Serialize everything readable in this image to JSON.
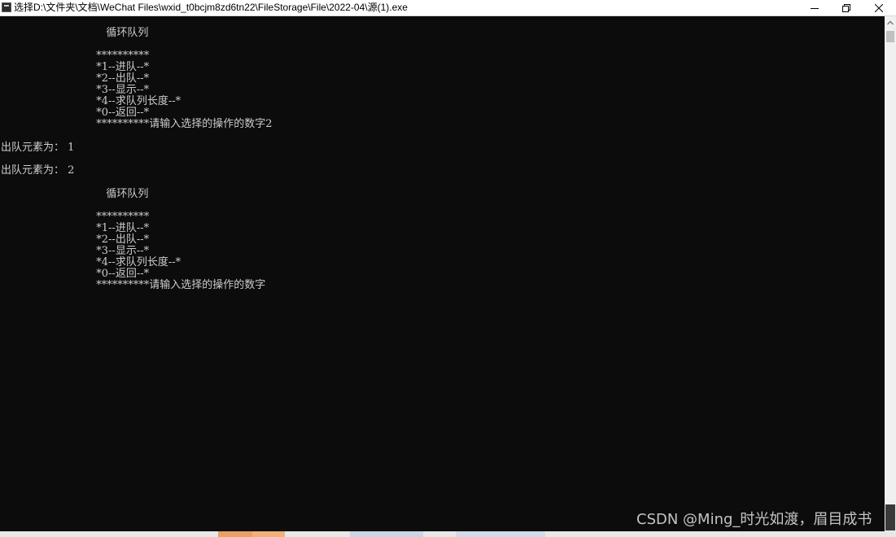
{
  "window": {
    "title": "选择D:\\文件夹\\文档\\WeChat Files\\wxid_t0bcjm8zd6tn22\\FileStorage\\File\\2022-04\\源(1).exe",
    "icon": "console-app-icon"
  },
  "title_buttons": [
    "minimize-icon",
    "restore-icon",
    "close-icon"
  ],
  "console": {
    "lines": [
      "   循环队列",
      "",
      "  **********",
      "  *1--进队--*",
      "  *2--出队--*",
      "  *3--显示--*",
      "  *4--求队列长度--*",
      "  *0--返回--*",
      "  **********请输入选择的操作的数字2",
      "",
      "出队元素为： 1",
      "",
      "出队元素为： 2",
      "",
      "   循环队列",
      "",
      "  **********",
      "  *1--进队--*",
      "  *2--出队--*",
      "  *3--显示--*",
      "  *4--求队列长度--*",
      "  *0--返回--*",
      "  **********请输入选择的操作的数字"
    ]
  },
  "watermark": "CSDN @Ming_时光如渡，眉目成书",
  "colors": {
    "console_bg": "#0c0c0c",
    "console_text": "#cccccc",
    "titlebar_bg": "#ffffff"
  }
}
